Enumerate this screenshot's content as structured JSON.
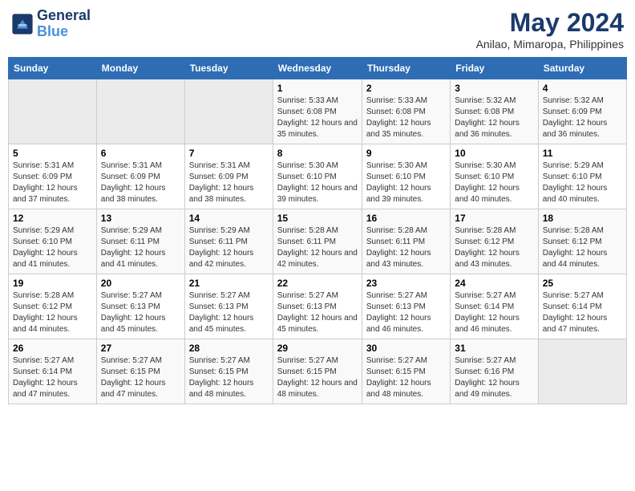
{
  "header": {
    "logo_line1": "General",
    "logo_line2": "Blue",
    "month_title": "May 2024",
    "location": "Anilao, Mimaropa, Philippines"
  },
  "weekdays": [
    "Sunday",
    "Monday",
    "Tuesday",
    "Wednesday",
    "Thursday",
    "Friday",
    "Saturday"
  ],
  "weeks": [
    [
      {
        "day": "",
        "sunrise": "",
        "sunset": "",
        "daylight": ""
      },
      {
        "day": "",
        "sunrise": "",
        "sunset": "",
        "daylight": ""
      },
      {
        "day": "",
        "sunrise": "",
        "sunset": "",
        "daylight": ""
      },
      {
        "day": "1",
        "sunrise": "5:33 AM",
        "sunset": "6:08 PM",
        "daylight": "12 hours and 35 minutes."
      },
      {
        "day": "2",
        "sunrise": "5:33 AM",
        "sunset": "6:08 PM",
        "daylight": "12 hours and 35 minutes."
      },
      {
        "day": "3",
        "sunrise": "5:32 AM",
        "sunset": "6:08 PM",
        "daylight": "12 hours and 36 minutes."
      },
      {
        "day": "4",
        "sunrise": "5:32 AM",
        "sunset": "6:09 PM",
        "daylight": "12 hours and 36 minutes."
      }
    ],
    [
      {
        "day": "5",
        "sunrise": "5:31 AM",
        "sunset": "6:09 PM",
        "daylight": "12 hours and 37 minutes."
      },
      {
        "day": "6",
        "sunrise": "5:31 AM",
        "sunset": "6:09 PM",
        "daylight": "12 hours and 38 minutes."
      },
      {
        "day": "7",
        "sunrise": "5:31 AM",
        "sunset": "6:09 PM",
        "daylight": "12 hours and 38 minutes."
      },
      {
        "day": "8",
        "sunrise": "5:30 AM",
        "sunset": "6:10 PM",
        "daylight": "12 hours and 39 minutes."
      },
      {
        "day": "9",
        "sunrise": "5:30 AM",
        "sunset": "6:10 PM",
        "daylight": "12 hours and 39 minutes."
      },
      {
        "day": "10",
        "sunrise": "5:30 AM",
        "sunset": "6:10 PM",
        "daylight": "12 hours and 40 minutes."
      },
      {
        "day": "11",
        "sunrise": "5:29 AM",
        "sunset": "6:10 PM",
        "daylight": "12 hours and 40 minutes."
      }
    ],
    [
      {
        "day": "12",
        "sunrise": "5:29 AM",
        "sunset": "6:10 PM",
        "daylight": "12 hours and 41 minutes."
      },
      {
        "day": "13",
        "sunrise": "5:29 AM",
        "sunset": "6:11 PM",
        "daylight": "12 hours and 41 minutes."
      },
      {
        "day": "14",
        "sunrise": "5:29 AM",
        "sunset": "6:11 PM",
        "daylight": "12 hours and 42 minutes."
      },
      {
        "day": "15",
        "sunrise": "5:28 AM",
        "sunset": "6:11 PM",
        "daylight": "12 hours and 42 minutes."
      },
      {
        "day": "16",
        "sunrise": "5:28 AM",
        "sunset": "6:11 PM",
        "daylight": "12 hours and 43 minutes."
      },
      {
        "day": "17",
        "sunrise": "5:28 AM",
        "sunset": "6:12 PM",
        "daylight": "12 hours and 43 minutes."
      },
      {
        "day": "18",
        "sunrise": "5:28 AM",
        "sunset": "6:12 PM",
        "daylight": "12 hours and 44 minutes."
      }
    ],
    [
      {
        "day": "19",
        "sunrise": "5:28 AM",
        "sunset": "6:12 PM",
        "daylight": "12 hours and 44 minutes."
      },
      {
        "day": "20",
        "sunrise": "5:27 AM",
        "sunset": "6:13 PM",
        "daylight": "12 hours and 45 minutes."
      },
      {
        "day": "21",
        "sunrise": "5:27 AM",
        "sunset": "6:13 PM",
        "daylight": "12 hours and 45 minutes."
      },
      {
        "day": "22",
        "sunrise": "5:27 AM",
        "sunset": "6:13 PM",
        "daylight": "12 hours and 45 minutes."
      },
      {
        "day": "23",
        "sunrise": "5:27 AM",
        "sunset": "6:13 PM",
        "daylight": "12 hours and 46 minutes."
      },
      {
        "day": "24",
        "sunrise": "5:27 AM",
        "sunset": "6:14 PM",
        "daylight": "12 hours and 46 minutes."
      },
      {
        "day": "25",
        "sunrise": "5:27 AM",
        "sunset": "6:14 PM",
        "daylight": "12 hours and 47 minutes."
      }
    ],
    [
      {
        "day": "26",
        "sunrise": "5:27 AM",
        "sunset": "6:14 PM",
        "daylight": "12 hours and 47 minutes."
      },
      {
        "day": "27",
        "sunrise": "5:27 AM",
        "sunset": "6:15 PM",
        "daylight": "12 hours and 47 minutes."
      },
      {
        "day": "28",
        "sunrise": "5:27 AM",
        "sunset": "6:15 PM",
        "daylight": "12 hours and 48 minutes."
      },
      {
        "day": "29",
        "sunrise": "5:27 AM",
        "sunset": "6:15 PM",
        "daylight": "12 hours and 48 minutes."
      },
      {
        "day": "30",
        "sunrise": "5:27 AM",
        "sunset": "6:15 PM",
        "daylight": "12 hours and 48 minutes."
      },
      {
        "day": "31",
        "sunrise": "5:27 AM",
        "sunset": "6:16 PM",
        "daylight": "12 hours and 49 minutes."
      },
      {
        "day": "",
        "sunrise": "",
        "sunset": "",
        "daylight": ""
      }
    ]
  ]
}
